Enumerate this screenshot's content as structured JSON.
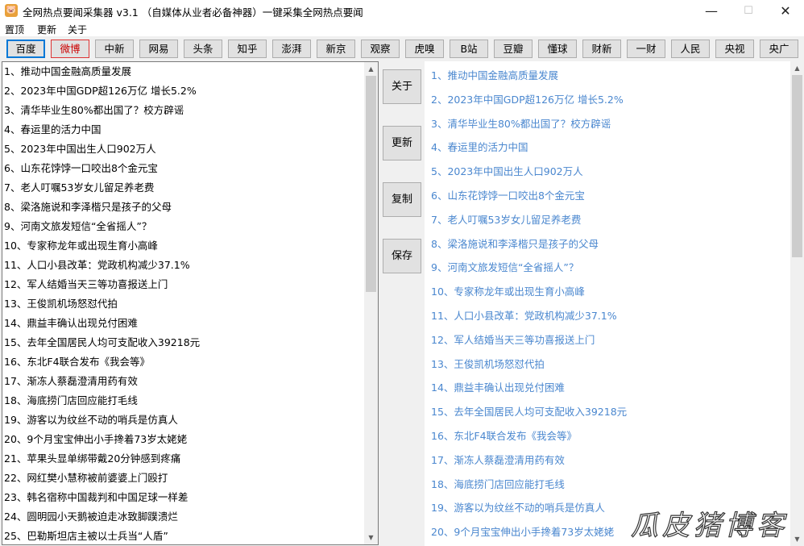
{
  "window": {
    "icon": "pig-icon",
    "title": "全网热点要闻采集器  v3.1   （自媒体从业者必备神器）一键采集全网热点要闻",
    "controls": {
      "minimize": "—",
      "maximize": "☐",
      "close": "✕"
    }
  },
  "menu": [
    "置顶",
    "更新",
    "关于"
  ],
  "sources": [
    "百度",
    "微博",
    "中新",
    "网易",
    "头条",
    "知乎",
    "澎湃",
    "新京",
    "观察",
    "虎嗅",
    "B站",
    "豆瓣",
    "懂球",
    "财新",
    "一财",
    "人民",
    "央视",
    "央广"
  ],
  "actions": {
    "about": "关于",
    "update": "更新",
    "copy": "复制",
    "save": "保存"
  },
  "news_left": [
    "1、推动中国金融高质量发展",
    "2、2023年中国GDP超126万亿 增长5.2%",
    "3、清华毕业生80%都出国了？校方辟谣",
    "4、春运里的活力中国",
    "5、2023年中国出生人口902万人",
    "6、山东花饽饽一口咬出8个金元宝",
    "7、老人叮嘱53岁女儿留足养老费",
    "8、梁洛施说和李泽楷只是孩子的父母",
    "9、河南文旅发短信“全省摇人”？",
    "10、专家称龙年或出现生育小高峰",
    "11、人口小县改革：党政机构减少37.1%",
    "12、军人结婚当天三等功喜报送上门",
    "13、王俊凯机场怒怼代拍",
    "14、鼎益丰确认出现兑付困难",
    "15、去年全国居民人均可支配收入39218元",
    "16、东北F4联合发布《我会等》",
    "17、渐冻人蔡磊澄清用药有效",
    "18、海底捞门店回应能打毛线",
    "19、游客以为纹丝不动的哨兵是仿真人",
    "20、9个月宝宝伸出小手搀着73岁太姥姥",
    "21、苹果头显单绑带戴20分钟感到疼痛",
    "22、网红樊小慧称被前婆婆上门殴打",
    "23、韩名宿称中国裁判和中国足球一样差",
    "24、圆明园小天鹅被迫走冰致脚蹼溃烂",
    "25、巴勒斯坦店主被以士兵当“人盾”"
  ],
  "news_right": [
    "1、推动中国金融高质量发展",
    "2、2023年中国GDP超126万亿 增长5.2%",
    "3、清华毕业生80%都出国了？校方辟谣",
    "4、春运里的活力中国",
    "5、2023年中国出生人口902万人",
    "6、山东花饽饽一口咬出8个金元宝",
    "7、老人叮嘱53岁女儿留足养老费",
    "8、梁洛施说和李泽楷只是孩子的父母",
    "9、河南文旅发短信“全省摇人”？",
    "10、专家称龙年或出现生育小高峰",
    "11、人口小县改革：党政机构减少37.1%",
    "12、军人结婚当天三等功喜报送上门",
    "13、王俊凯机场怒怼代拍",
    "14、鼎益丰确认出现兑付困难",
    "15、去年全国居民人均可支配收入39218元",
    "16、东北F4联合发布《我会等》",
    "17、渐冻人蔡磊澄清用药有效",
    "18、海底捞门店回应能打毛线",
    "19、游客以为纹丝不动的哨兵是仿真人",
    "20、9个月宝宝伸出小手搀着73岁太姥姥"
  ],
  "watermark": "瓜皮猪博客",
  "colors": {
    "link": "#4a87cf",
    "focus": "#0078d7",
    "hot": "#cc0000"
  }
}
